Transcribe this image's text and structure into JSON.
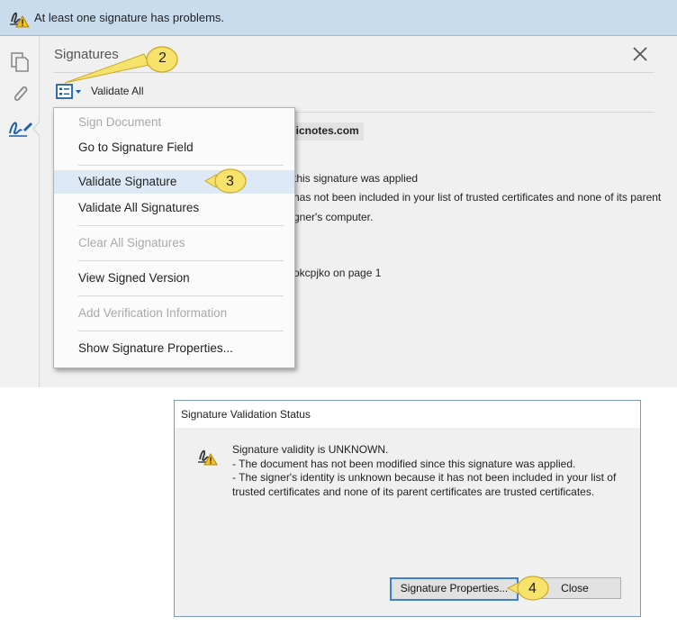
{
  "banner": {
    "message": "At least one signature has problems."
  },
  "panel": {
    "title": "Signatures",
    "validate_all_label": "Validate All",
    "sig_info": {
      "heading": "sicnotes.com",
      "line1": "this signature was applied",
      "line2": "has not been included in your list of trusted certificates and none of its parent",
      "line3": "gner's computer.",
      "line4": "okcpjko on page 1"
    }
  },
  "menu": {
    "items": [
      {
        "label": "Sign Document",
        "enabled": false
      },
      {
        "label": "Go to Signature Field",
        "enabled": true
      },
      {
        "label": "Validate Signature",
        "enabled": true,
        "highlighted": true
      },
      {
        "label": "Validate All Signatures",
        "enabled": true
      },
      {
        "label": "Clear All Signatures",
        "enabled": false
      },
      {
        "label": "View Signed Version",
        "enabled": true
      },
      {
        "label": "Add Verification Information",
        "enabled": false
      },
      {
        "label": "Show Signature Properties...",
        "enabled": true
      }
    ]
  },
  "callouts": {
    "c2": "2",
    "c3": "3",
    "c4": "4"
  },
  "dialog": {
    "title": "Signature Validation Status",
    "message_lines": [
      "Signature validity is UNKNOWN.",
      "- The document has not been modified since this signature was applied.",
      "- The signer's identity is unknown because it has not been included in your list of",
      "trusted certificates and none of its parent certificates are trusted certificates."
    ],
    "props_button": "Signature Properties...",
    "close_button": "Close"
  },
  "icons": {
    "banner": "signature-warning-icon",
    "rail": [
      "pages-icon",
      "attachment-icon",
      "signature-pen-icon"
    ],
    "dialog": "signature-warning-icon"
  },
  "colors": {
    "callout_fill": "#f7e26b",
    "callout_border": "#c9a82a",
    "banner_bg": "#c9dcee",
    "accent": "#1c5ea8"
  }
}
